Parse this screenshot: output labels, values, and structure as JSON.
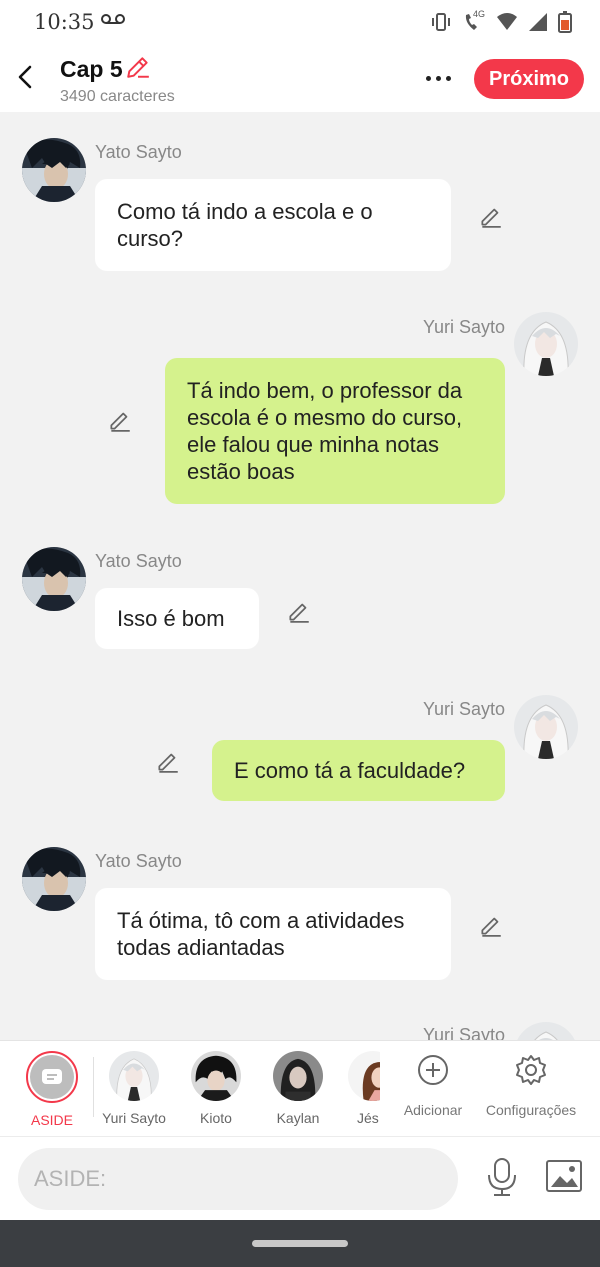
{
  "status": {
    "time": "10:35",
    "network": "4G"
  },
  "header": {
    "title": "Cap 5",
    "subtitle": "3490 caracteres",
    "next_label": "Próximo"
  },
  "messages": [
    {
      "sender": "Yato Sayto",
      "text": "Como tá indo a escola e o curso?",
      "side": "left"
    },
    {
      "sender": "Yuri Sayto",
      "text": "Tá indo bem, o professor da escola é o mesmo do curso, ele falou que minha notas estão boas",
      "side": "right"
    },
    {
      "sender": "Yato Sayto",
      "text": "Isso é bom",
      "side": "left"
    },
    {
      "sender": "Yuri Sayto",
      "text": "E como tá a faculdade?",
      "side": "right"
    },
    {
      "sender": "Yato Sayto",
      "text": "Tá ótima, tô com a atividades todas adiantadas",
      "side": "left"
    },
    {
      "sender": "Yuri Sayto",
      "text": "",
      "side": "right"
    }
  ],
  "characters": [
    {
      "label": "ASIDE",
      "selected": true,
      "icon": "message-icon"
    },
    {
      "label": "Yuri Sayto"
    },
    {
      "label": "Kioto"
    },
    {
      "label": "Kaylan"
    },
    {
      "label": "Jés"
    }
  ],
  "tools": {
    "add_label": "Adicionar",
    "settings_label": "Configurações"
  },
  "input": {
    "placeholder": "ASIDE:"
  },
  "colors": {
    "accent": "#f3384a",
    "bubble_left": "#ffffff",
    "bubble_right": "#d5f28d",
    "background": "#f2f2f2"
  }
}
